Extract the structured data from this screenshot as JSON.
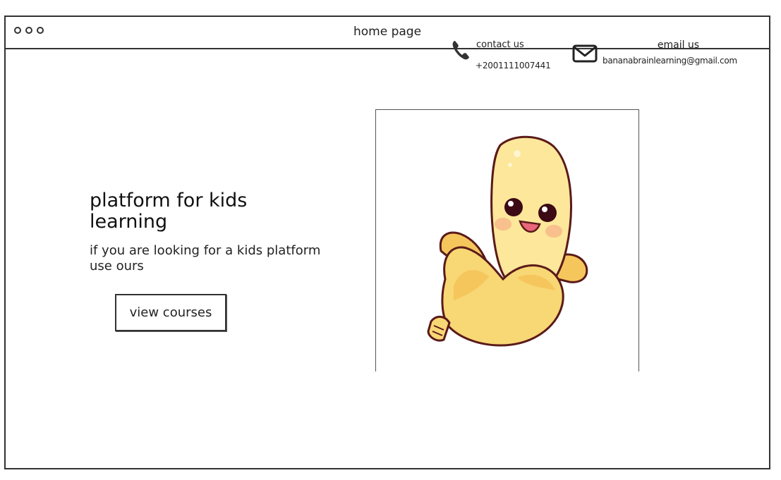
{
  "window": {
    "title": "home page"
  },
  "contact": {
    "label": "contact us",
    "phone": "+2001111007441",
    "phone_icon": "phone-icon"
  },
  "email": {
    "label": "email us",
    "address": "bananabrainlearning@gmail.com",
    "mail_icon": "envelope-icon"
  },
  "hero": {
    "title": "platform for kids learning",
    "subtitle": "if you are looking for a kids platform use ours",
    "button_label": "view courses"
  },
  "illustration": {
    "subject": "banana-mascot"
  },
  "colors": {
    "banana_fill": "#FCE79A",
    "banana_dark": "#F5C65C",
    "outline": "#5A1A1A",
    "cheek": "#F7B98A"
  }
}
